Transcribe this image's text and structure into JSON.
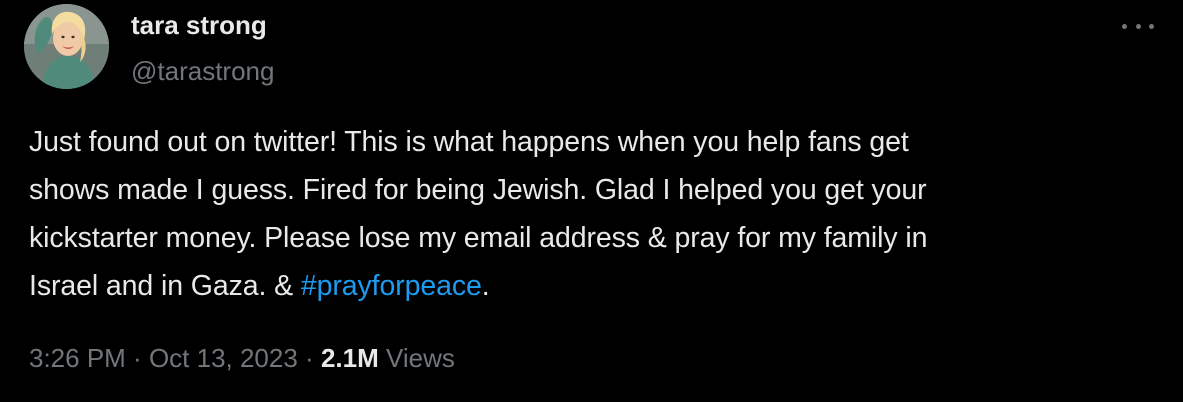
{
  "author": {
    "display_name": "tara strong",
    "handle": "@tarastrong"
  },
  "more_icon": "more-horizontal-icon",
  "tweet": {
    "lines": [
      "Just found out on twitter! This is what happens when you help fans get",
      "shows made I guess. Fired for being Jewish. Glad I helped you get your",
      "kickstarter money. Please lose my email address & pray for my family in"
    ],
    "last_line_prefix": "Israel and in Gaza. & ",
    "hashtag": "#prayforpeace",
    "last_line_suffix": "."
  },
  "meta": {
    "time": "3:26 PM",
    "separator": " · ",
    "date": "Oct 13, 2023",
    "views_count": "2.1M",
    "views_label": " Views"
  },
  "colors": {
    "background": "#000000",
    "text": "#e7e9ea",
    "muted": "#71767b",
    "link": "#1d9bf0"
  }
}
